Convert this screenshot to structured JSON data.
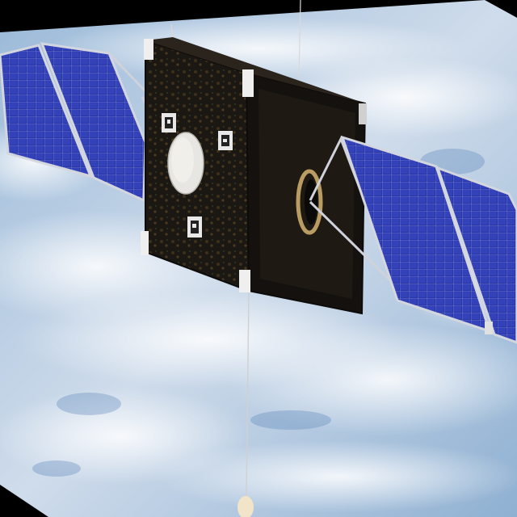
{
  "image": {
    "kind": "photo-render",
    "subject": "satellite",
    "colors": {
      "background": "#000000",
      "sky": "#8fb3d6",
      "cloud": "#eef3f8",
      "panel_blue": "#27339f",
      "panel_grid": "#6e7fd8",
      "panel_frame": "#c9ccd6",
      "bus_dark": "#1a1612",
      "bus_gold": "#5a4424",
      "marker": "#e8e8e8",
      "dish": "#e6e4e0"
    }
  }
}
